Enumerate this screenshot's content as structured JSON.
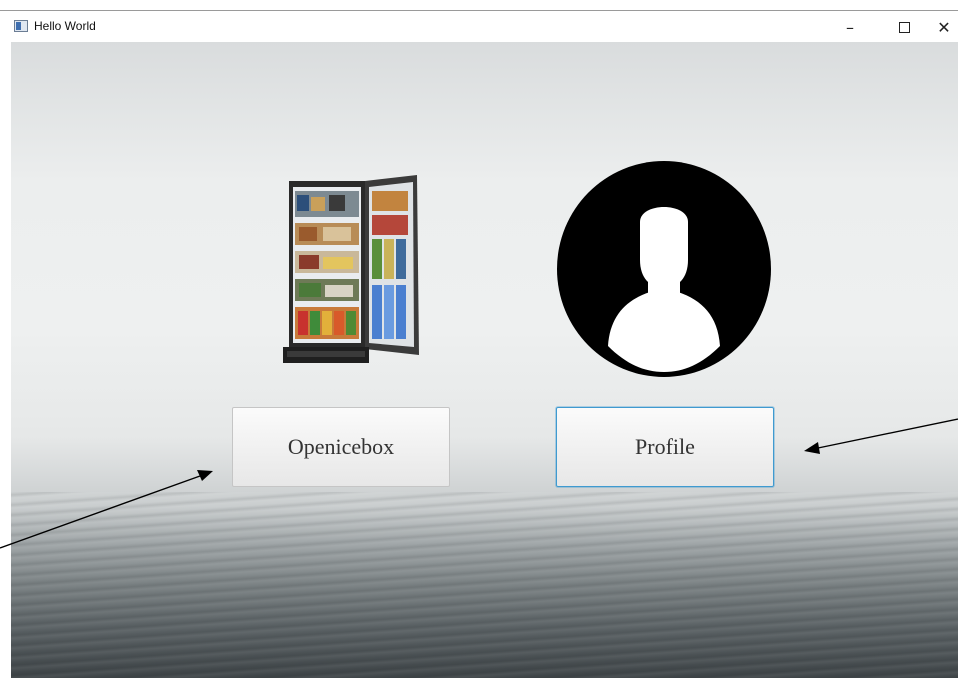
{
  "window": {
    "title": "Hello World",
    "controls": {
      "minimize": "–",
      "close": "✕"
    }
  },
  "buttons": {
    "openicebox": "Openicebox",
    "profile": "Profile"
  },
  "icons": {
    "fridge": "fridge-icon",
    "profile": "user-avatar-icon"
  },
  "colors": {
    "focus_border": "#3f9ad0",
    "button_text": "#333333"
  }
}
